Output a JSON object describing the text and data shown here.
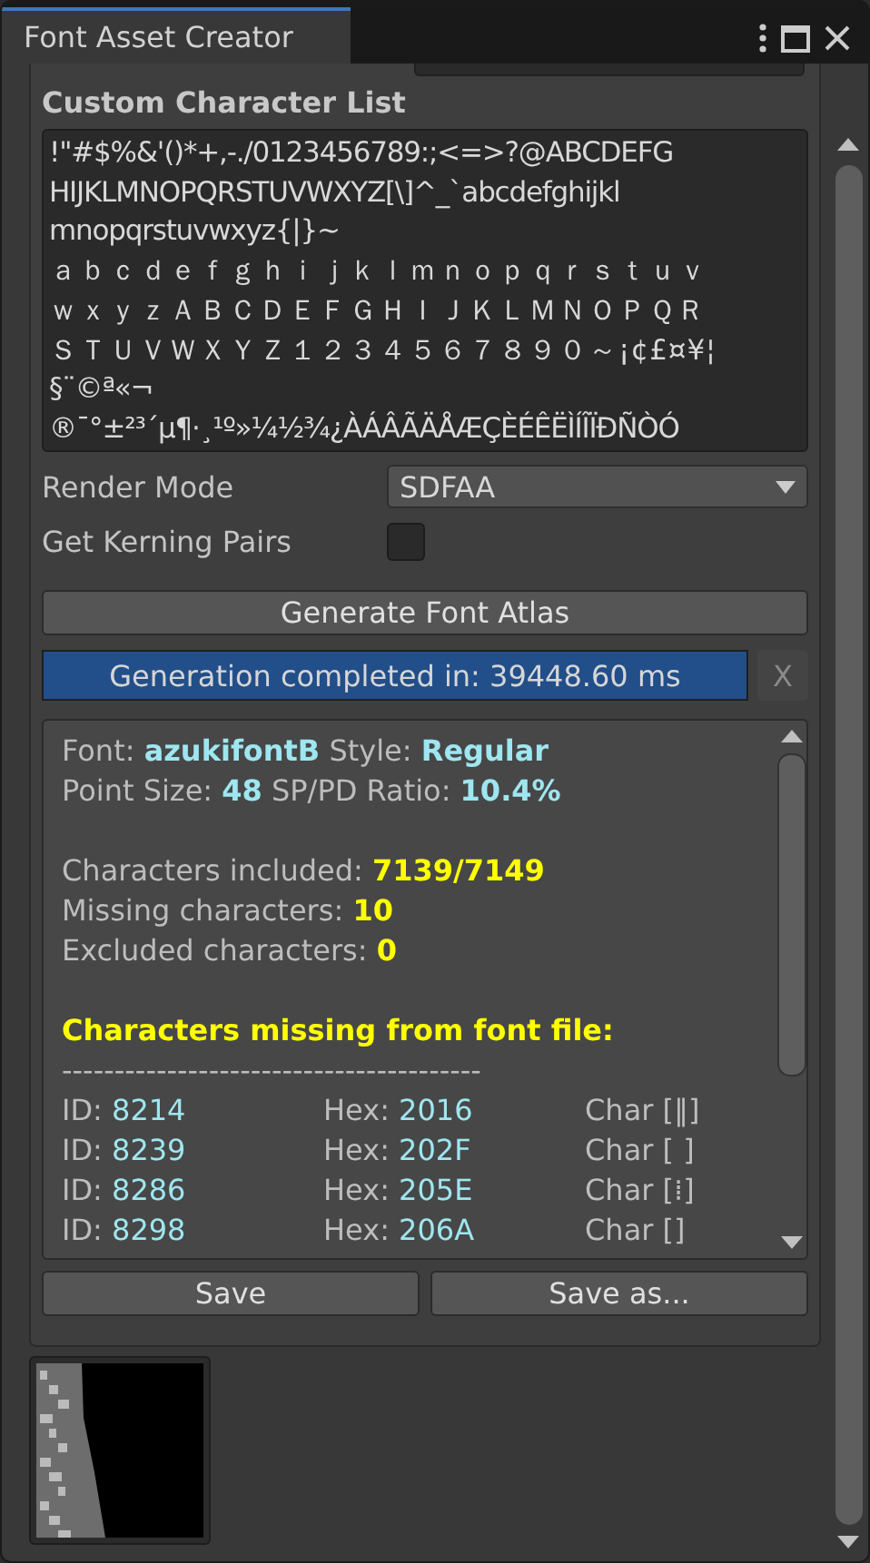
{
  "window": {
    "title": "Font Asset Creator"
  },
  "custom_character_list": {
    "label": "Custom Character List",
    "lines": [
      "!\"#$%&'()*+,-./0123456789:;<=>?@ABCDEFG",
      "HIJKLMNOPQRSTUVWXYZ[\\]^_`abcdefghijkl",
      "mnopqrstuvwxyz{|}~",
      "ａｂｃｄｅｆｇｈｉｊｋｌｍｎｏｐｑｒｓｔｕｖ",
      "ｗｘｙｚＡＢＣＤＥＦＧＨＩＪＫＬＭＮＯＰＱＲ",
      "ＳＴＵＶＷＸＹＺ１２３４５６７８９０～¡¢£¤¥¦",
      "§¨©ª«¬",
      "®¯°±²³´µ¶·¸¹º»¼½¾¿ÀÁÂÃÄÅÆÇÈÉÊËÌÍÎÏÐÑÒÓ"
    ]
  },
  "render_mode": {
    "label": "Render Mode",
    "value": "SDFAA"
  },
  "kerning": {
    "label": "Get Kerning Pairs",
    "checked": false
  },
  "generate_button": "Generate Font Atlas",
  "progress": {
    "text": "Generation completed in: 39448.60 ms",
    "level": 1,
    "close": "X"
  },
  "report": {
    "paragraphs": [
      [
        [
          {
            "text": "Font: "
          },
          {
            "text": "azukifontB",
            "color": "#9ee6f0"
          },
          {
            "text": "  Style: "
          },
          {
            "text": "Regular",
            "color": "#9ee6f0"
          }
        ],
        [
          {
            "text": "Point Size: "
          },
          {
            "text": "48",
            "color": "#9ee6f0"
          },
          {
            "text": "   SP/PD Ratio: "
          },
          {
            "text": "10.4%",
            "color": "#9ee6f0"
          }
        ]
      ],
      [
        [
          {
            "text": "Characters included: "
          },
          {
            "text": "7139/7149",
            "color": "#ffff00"
          }
        ],
        [
          {
            "text": "Missing characters: "
          },
          {
            "text": "10",
            "color": "#ffff00"
          }
        ],
        [
          {
            "text": "Excluded characters: "
          },
          {
            "text": "0",
            "color": "#ffff00"
          }
        ]
      ],
      [
        [
          {
            "text": "Characters missing from font file:",
            "color": "#ffff00"
          }
        ],
        [
          {
            "text": "----------------------------------------"
          }
        ]
      ]
    ],
    "missing": [
      {
        "id_label": "ID: ",
        "id": "8214",
        "hex_label": "Hex: ",
        "hex": "2016",
        "char": "Char [‖]"
      },
      {
        "id_label": "ID: ",
        "id": "8239",
        "hex_label": "Hex: ",
        "hex": "202F",
        "char": "Char [ ]"
      },
      {
        "id_label": "ID: ",
        "id": "8286",
        "hex_label": "Hex: ",
        "hex": "205E",
        "char": "Char [⁞]"
      },
      {
        "id_label": "ID: ",
        "id": "8298",
        "hex_label": "Hex: ",
        "hex": "206A",
        "char": "Char [⁪]"
      }
    ]
  },
  "buttons": [
    "Save",
    "Save as..."
  ]
}
